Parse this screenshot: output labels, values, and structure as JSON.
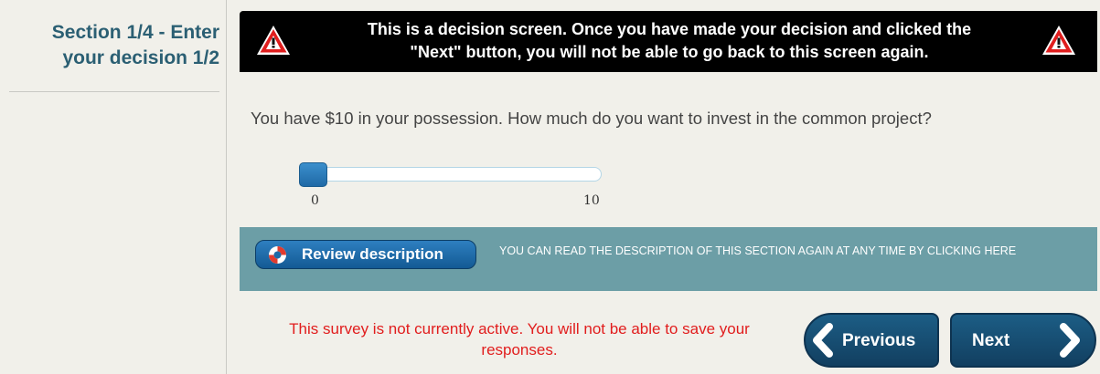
{
  "sidebar": {
    "title_line1": "Section 1/4 - Enter",
    "title_line2": "your decision 1/2"
  },
  "banner": {
    "line1": "This is a decision screen. Once you have made your decision and clicked the",
    "line2": "\"Next\" button, you will not be able to go back to this screen again.",
    "icon": "warning-triangle-icon"
  },
  "question": {
    "text": "You have $10 in your possession. How much do you want to invest in the common project?"
  },
  "slider": {
    "min_label": "0",
    "max_label": "10",
    "min": 0,
    "max": 10,
    "value": 0
  },
  "review": {
    "button_label": "Review description",
    "note": "YOU CAN READ THE DESCRIPTION OF THIS SECTION AGAIN AT ANY TIME BY CLICKING HERE"
  },
  "status": {
    "message_line1": "This survey is not currently active. You will not be able to save your",
    "message_line2": "responses."
  },
  "nav": {
    "previous_label": "Previous",
    "next_label": "Next"
  },
  "colors": {
    "accent": "#1c5d85",
    "sidebar_title": "#2b5f73",
    "review_bar": "#6c9ea6",
    "error": "#e11d1d"
  }
}
